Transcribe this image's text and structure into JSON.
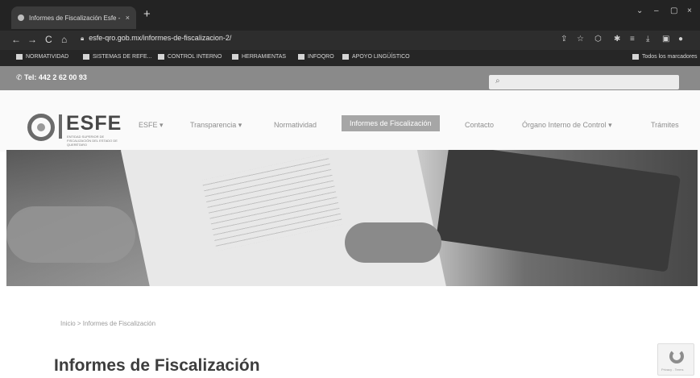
{
  "browser": {
    "tab_title": "Informes de Fiscalización Esfe - E",
    "tab_close": "×",
    "new_tab": "+",
    "url": "esfe-qro.gob.mx/informes-de-fiscalizacion-2/",
    "window_controls": [
      "⌄",
      "–",
      "▢",
      "×"
    ],
    "nav": {
      "back": "←",
      "forward": "→",
      "reload": "C",
      "home": "⌂"
    },
    "bookmarks": [
      "NORMATIVIDAD",
      "SISTEMAS DE REFE...",
      "CONTROL INTERNO",
      "HERRAMIENTAS",
      "INFOQRO",
      "APOYO LINGÜÍSTICO"
    ],
    "bookmarks_right": "Todos los marcadores"
  },
  "site": {
    "phone": "Tel: 442 2 62 00 93",
    "logo": {
      "name": "ESFE",
      "subtitle": "ENTIDAD SUPERIOR DE FISCALIZACIÓN DEL ESTADO DE QUERÉTARO"
    },
    "menu": [
      {
        "label": "ESFE ▾"
      },
      {
        "label": "Transparencia ▾"
      },
      {
        "label": "Normatividad"
      },
      {
        "label": "Informes de Fiscalización"
      },
      {
        "label": "Contacto"
      },
      {
        "label": "Órgano Interno de Control ▾"
      },
      {
        "label": "Trámites"
      }
    ],
    "breadcrumb": "Inicio > Informes de Fiscalización",
    "page_title": "Informes de Fiscalización",
    "recaptcha_text": "Privacy - Terms"
  }
}
